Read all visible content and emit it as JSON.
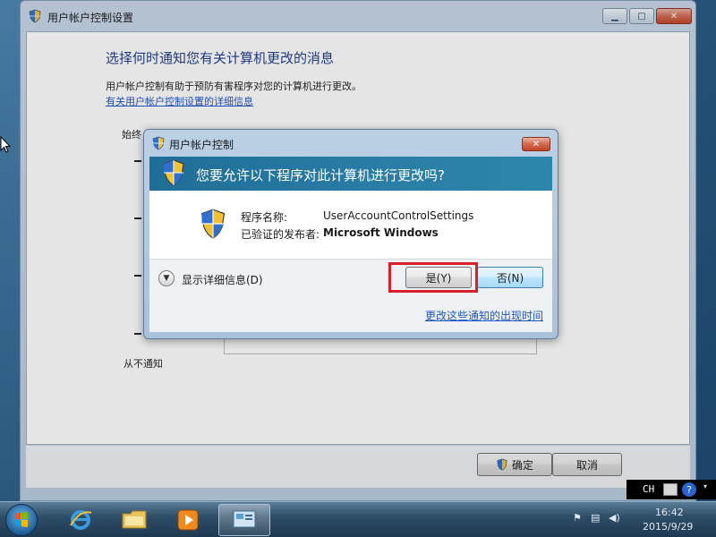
{
  "settings_window": {
    "title": "用户帐户控制设置",
    "caption_buttons": {
      "minimize": "▁",
      "maximize": "▢",
      "close": "✕"
    },
    "heading": "选择何时通知您有关计算机更改的消息",
    "description": "用户帐户控制有助于预防有害程序对您的计算机进行更改。",
    "details_link": "有关用户帐户控制设置的详细信息",
    "slider_top_label": "始终",
    "slider_bottom_label": "从不通知",
    "ok_label": "确定",
    "cancel_label": "取消"
  },
  "uac_dialog": {
    "title": "用户帐户控制",
    "close_glyph": "✕",
    "question": "您要允许以下程序对此计算机进行更改吗?",
    "program_name_label": "程序名称:",
    "program_name": "UserAccountControlSettings",
    "publisher_label": "已验证的发布者:",
    "publisher": "Microsoft Windows",
    "details_label": "显示详细信息(D)",
    "yes_label": "是(Y)",
    "no_label": "否(N)",
    "notify_link": "更改这些通知的出现时间",
    "highlight_color": "#d9202a"
  },
  "taskbar": {
    "items": [
      {
        "name": "start",
        "icon": "windows-logo-icon"
      },
      {
        "name": "internet-explorer",
        "icon": "internet-explorer-icon"
      },
      {
        "name": "explorer",
        "icon": "folder-icon"
      },
      {
        "name": "media-player",
        "icon": "media-player-icon"
      },
      {
        "name": "uac-settings",
        "icon": "control-panel-icon"
      }
    ],
    "language": "CH",
    "help_glyph": "?",
    "time": "16:42",
    "date": "2015/9/29"
  },
  "colors": {
    "heading": "#1e3e8a",
    "link": "#1f55c4",
    "uac_band": "#1f6e98"
  }
}
